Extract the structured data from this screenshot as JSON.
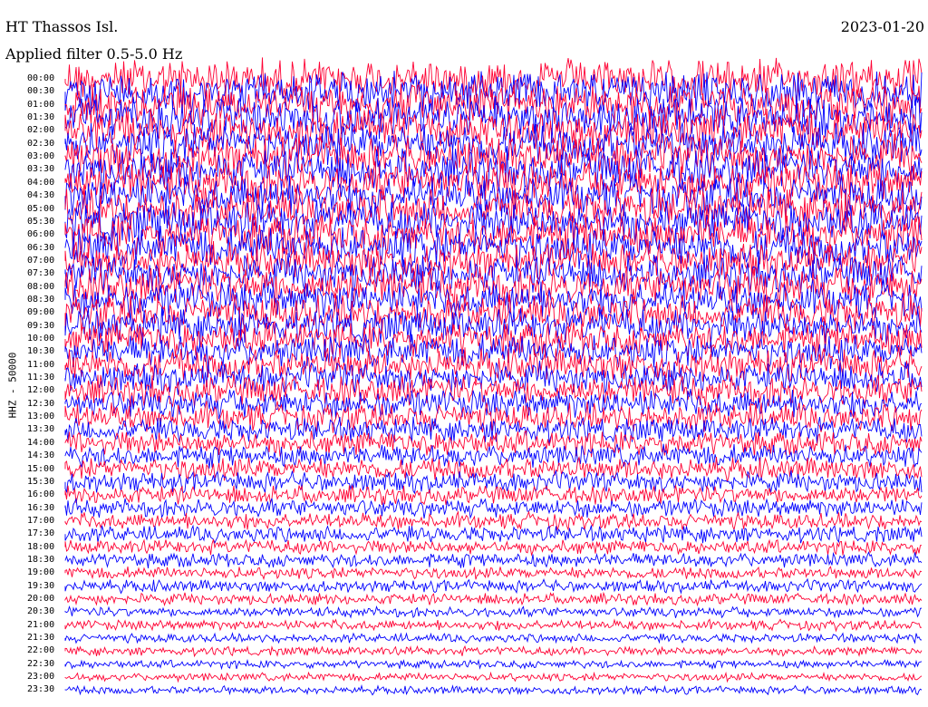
{
  "header": {
    "title": "HT Thassos Isl.",
    "date": "2023-01-20",
    "filter_text": "Applied filter 0.5-5.0 Hz"
  },
  "channel_label": "HHZ - 50000",
  "colors": {
    "trace_a": "#ff0033",
    "trace_b": "#0000ff",
    "background": "#ffffff"
  },
  "chart_data": {
    "type": "line",
    "title": "HT Thassos Isl.",
    "xlabel": "",
    "ylabel": "HHZ - 50000",
    "grid": false,
    "rows": [
      {
        "time": "00:00",
        "amplitude": 1.0
      },
      {
        "time": "00:30",
        "amplitude": 1.0
      },
      {
        "time": "01:00",
        "amplitude": 1.0
      },
      {
        "time": "01:30",
        "amplitude": 1.0
      },
      {
        "time": "02:00",
        "amplitude": 1.0
      },
      {
        "time": "02:30",
        "amplitude": 1.0
      },
      {
        "time": "03:00",
        "amplitude": 1.0
      },
      {
        "time": "03:30",
        "amplitude": 1.0
      },
      {
        "time": "04:00",
        "amplitude": 1.0
      },
      {
        "time": "04:30",
        "amplitude": 1.0
      },
      {
        "time": "05:00",
        "amplitude": 1.0
      },
      {
        "time": "05:30",
        "amplitude": 1.0
      },
      {
        "time": "06:00",
        "amplitude": 1.0
      },
      {
        "time": "06:30",
        "amplitude": 1.0
      },
      {
        "time": "07:00",
        "amplitude": 0.9
      },
      {
        "time": "07:30",
        "amplitude": 0.9
      },
      {
        "time": "08:00",
        "amplitude": 0.95
      },
      {
        "time": "08:30",
        "amplitude": 0.9
      },
      {
        "time": "09:00",
        "amplitude": 0.9
      },
      {
        "time": "09:30",
        "amplitude": 0.85
      },
      {
        "time": "10:00",
        "amplitude": 0.85
      },
      {
        "time": "10:30",
        "amplitude": 0.8
      },
      {
        "time": "11:00",
        "amplitude": 0.8
      },
      {
        "time": "11:30",
        "amplitude": 0.75
      },
      {
        "time": "12:00",
        "amplitude": 0.75
      },
      {
        "time": "12:30",
        "amplitude": 0.7
      },
      {
        "time": "13:00",
        "amplitude": 0.7
      },
      {
        "time": "13:30",
        "amplitude": 0.6
      },
      {
        "time": "14:00",
        "amplitude": 0.6
      },
      {
        "time": "14:30",
        "amplitude": 0.55
      },
      {
        "time": "15:00",
        "amplitude": 0.55
      },
      {
        "time": "15:30",
        "amplitude": 0.5
      },
      {
        "time": "16:00",
        "amplitude": 0.45
      },
      {
        "time": "16:30",
        "amplitude": 0.45
      },
      {
        "time": "17:00",
        "amplitude": 0.4
      },
      {
        "time": "17:30",
        "amplitude": 0.4
      },
      {
        "time": "18:00",
        "amplitude": 0.35
      },
      {
        "time": "18:30",
        "amplitude": 0.35
      },
      {
        "time": "19:00",
        "amplitude": 0.3
      },
      {
        "time": "19:30",
        "amplitude": 0.3
      },
      {
        "time": "20:00",
        "amplitude": 0.28
      },
      {
        "time": "20:30",
        "amplitude": 0.25
      },
      {
        "time": "21:00",
        "amplitude": 0.25
      },
      {
        "time": "21:30",
        "amplitude": 0.22
      },
      {
        "time": "22:00",
        "amplitude": 0.22
      },
      {
        "time": "22:30",
        "amplitude": 0.2
      },
      {
        "time": "23:00",
        "amplitude": 0.2
      },
      {
        "time": "23:30",
        "amplitude": 0.2
      }
    ]
  }
}
